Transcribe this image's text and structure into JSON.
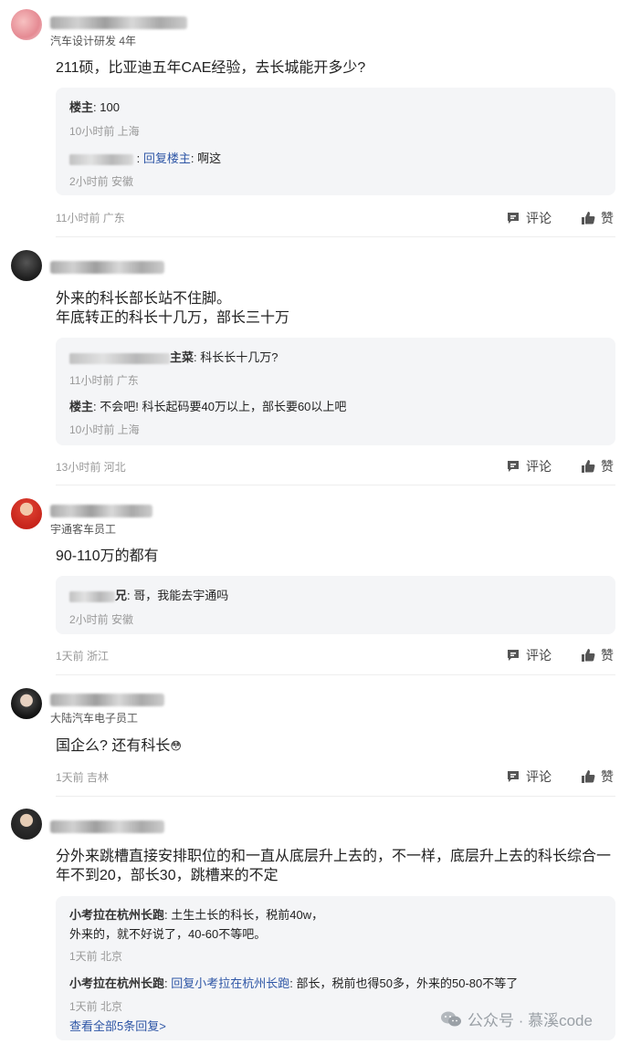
{
  "comments": [
    {
      "subtitle": "汽车设计研发 4年",
      "text": "211硕，比亚迪五年CAE经验，去长城能开多少?",
      "replies": [
        {
          "author": "楼主",
          "sep": ":",
          "content": "100",
          "meta": "10小时前 上海"
        },
        {
          "author": "",
          "link": "回复楼主",
          "sep": ":",
          "content": "啊这",
          "meta": "2小时前 安徽"
        }
      ],
      "meta": "11小时前 广东"
    },
    {
      "subtitle": "",
      "text_lines": [
        "外来的科长部长站不住脚。",
        "年底转正的科长十几万，部长三十万"
      ],
      "replies": [
        {
          "author": "",
          "author_tail": "主菜",
          "sep": ":",
          "content": "科长长十几万?",
          "meta": "11小时前 广东"
        },
        {
          "author": "楼主",
          "sep": ":",
          "content": "不会吧! 科长起码要40万以上，部长要60以上吧",
          "meta": "10小时前 上海"
        }
      ],
      "meta": "13小时前 河北"
    },
    {
      "subtitle": "宇通客车员工",
      "text": "90-110万的都有",
      "replies": [
        {
          "author": "",
          "author_tail": "兄",
          "sep": ":",
          "content": "哥，我能去宇通吗",
          "meta": "2小时前 安徽"
        }
      ],
      "meta": "1天前 浙江"
    },
    {
      "subtitle": "大陆汽车电子员工",
      "text": "国企么? 还有科长",
      "emoji": "😳",
      "meta": "1天前 吉林"
    },
    {
      "subtitle": "",
      "text_lines": [
        "分外来跳槽直接安排职位的和一直从底层升上去的，不一样，底层升上去的科长综合一",
        "年不到20，部长30，跳槽来的不定"
      ],
      "replies": [
        {
          "author": "小考拉在杭州长跑",
          "sep": ":",
          "content": "土生土长的科长，税前40w，",
          "content2": "外来的，就不好说了，40-60不等吧。",
          "meta": "1天前 北京"
        },
        {
          "author": "小考拉在杭州长跑",
          "sep": ":",
          "link": "回复小考拉在杭州长跑",
          "content": "部长，税前也得50多，外来的50-80不等了",
          "meta": "1天前 北京"
        }
      ],
      "more": "查看全部5条回复>",
      "meta": ""
    }
  ],
  "actions": {
    "comment_label": "评论",
    "like_label": "赞"
  },
  "watermark": "公众号 · 慕溪code",
  "colors": {
    "link": "#2e56a6",
    "meta": "#999999",
    "reply_bg": "#f4f5f7"
  }
}
